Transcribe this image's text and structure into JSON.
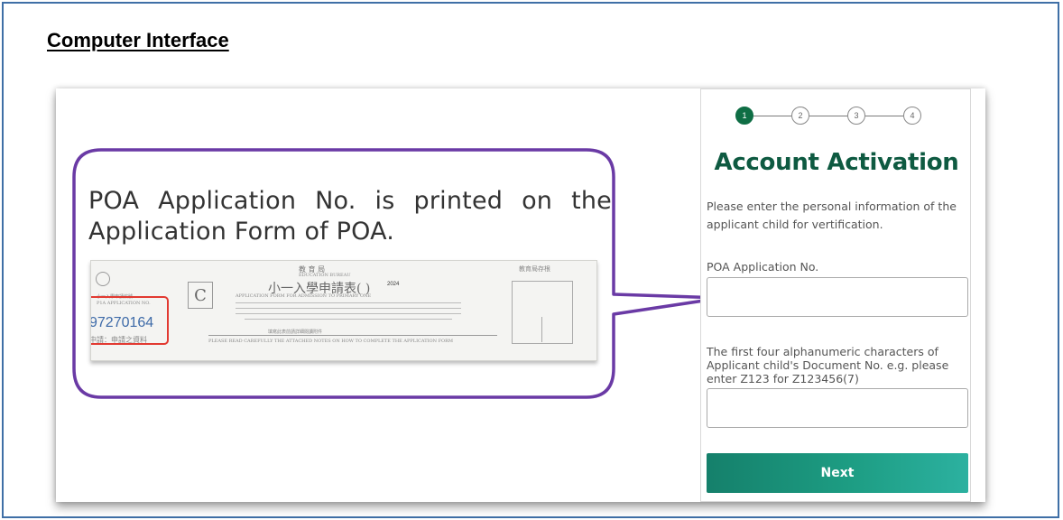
{
  "page": {
    "heading": "Computer Interface"
  },
  "colors": {
    "frame_border": "#3f6fa6",
    "callout_border": "#6a3aa5",
    "accent_green": "#0e5a41",
    "step_active": "#0f6e45",
    "button_gradient_start": "#15806b",
    "button_gradient_end": "#2cb1a0",
    "highlight_red": "#e23a32"
  },
  "callout": {
    "text": "POA Application No. is printed on the Application Form of POA.",
    "form_image": {
      "application_no": "97270164",
      "box_letter": "C",
      "year": "2024",
      "title_cn": "小一入學申請表(    )",
      "dept_cn": "教 育 局",
      "right_header": "教育局存根",
      "left_label_cn": "小一入學申請編號",
      "left_bottom_cn": "中請：申請之資料"
    }
  },
  "panel": {
    "steps": [
      "1",
      "2",
      "3",
      "4"
    ],
    "active_step": 1,
    "title": "Account Activation",
    "description": "Please enter the personal information of the applicant child for vertification.",
    "field1": {
      "label": "POA Application No.",
      "value": ""
    },
    "field2": {
      "label": "The first four alphanumeric characters of Applicant child's Document No. e.g. please enter Z123 for Z123456(7)",
      "value": ""
    },
    "next_button": "Next"
  }
}
